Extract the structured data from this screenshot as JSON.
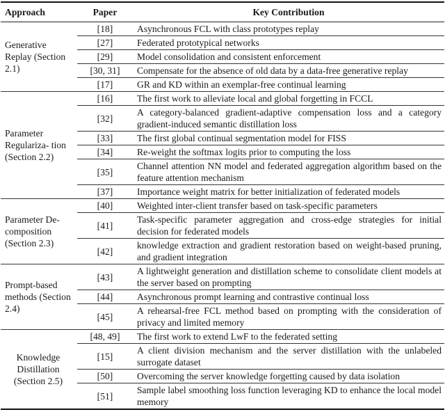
{
  "table": {
    "headers": {
      "approach": "Approach",
      "paper": "Paper",
      "key_contribution": "Key Contribution"
    },
    "groups": [
      {
        "approach": "Generative Replay (Section 2.1)",
        "rows": [
          {
            "paper": "[18]",
            "contribution": "Asynchronous FCL with class prototypes replay"
          },
          {
            "paper": "[27]",
            "contribution": "Federated prototypical networks"
          },
          {
            "paper": "[29]",
            "contribution": "Model consolidation and consistent enforcement"
          },
          {
            "paper": "[30, 31]",
            "contribution": "Compensate for the absence of old data by a data-free generative replay"
          },
          {
            "paper": "[17]",
            "contribution": "GR and KD within an exemplar-free continual learning"
          }
        ]
      },
      {
        "approach": "Parameter Regulariza- tion (Section 2.2)",
        "rows": [
          {
            "paper": "[16]",
            "contribution": "The first work to alleviate local and global forgetting in FCCL"
          },
          {
            "paper": "[32]",
            "contribution": "A category-balanced gradient-adaptive compensation loss and a category gradient-induced semantic distillation loss"
          },
          {
            "paper": "[33]",
            "contribution": "The first global continual segmentation model for FISS"
          },
          {
            "paper": "[34]",
            "contribution": "Re-weight the softmax logits prior to computing the loss"
          },
          {
            "paper": "[35]",
            "contribution": "Channel attention NN model and federated aggregation algorithm based on the feature attention mechanism"
          },
          {
            "paper": "[37]",
            "contribution": "Importance weight matrix for better initialization of federated models"
          }
        ]
      },
      {
        "approach": "Parameter De- composition (Section 2.3)",
        "rows": [
          {
            "paper": "[40]",
            "contribution": "Weighted inter-client transfer based on task-specific parameters"
          },
          {
            "paper": "[41]",
            "contribution": "Task-specific parameter aggregation and cross-edge strategies for initial decision for federated models"
          },
          {
            "paper": "[42]",
            "contribution": "knowledge extraction and gradient restoration based on weight-based pruning, and gradient integration"
          }
        ]
      },
      {
        "approach": "Prompt-based methods (Section 2.4)",
        "rows": [
          {
            "paper": "[43]",
            "contribution": "A lightweight generation and distillation scheme to consolidate client models at the server based on prompting"
          },
          {
            "paper": "[44]",
            "contribution": "Asynchronous prompt learning and contrastive continual loss"
          },
          {
            "paper": "[45]",
            "contribution": "A rehearsal-free FCL method based on prompting with the consideration of privacy and limited memory"
          }
        ]
      },
      {
        "approach": "Knowledge Distillation (Section 2.5)",
        "rows": [
          {
            "paper": "[48, 49]",
            "contribution": "The first work to extend LwF to the federated setting"
          },
          {
            "paper": "[15]",
            "contribution": "A client division mechanism and the server distillation with the unlabeled surrogate dataset"
          },
          {
            "paper": "[50]",
            "contribution": "Overcoming the server knowledge forgetting caused by data isolation"
          },
          {
            "paper": "[51]",
            "contribution": "Sample label smoothing loss function leveraging KD to enhance the local model memory"
          }
        ]
      }
    ]
  }
}
